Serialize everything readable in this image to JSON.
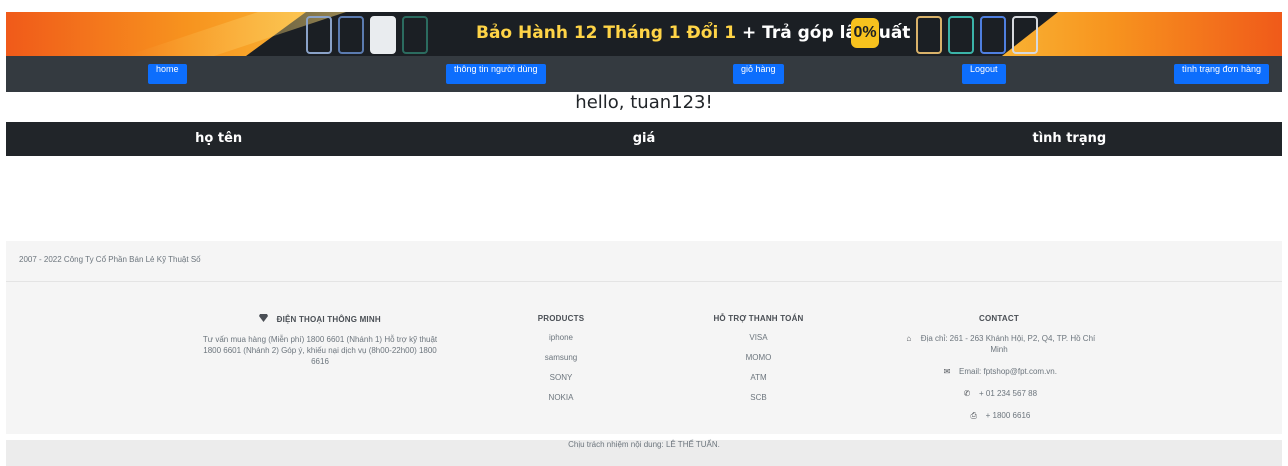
{
  "banner": {
    "warranty_text": "Bảo Hành 12 Tháng 1 Đổi 1",
    "plus": "+",
    "installment_text": "Trả góp lãi suất",
    "zero_percent": "0%"
  },
  "nav": {
    "home": "home",
    "user_info": "thông tin người dùng",
    "cart": "giỏ hàng",
    "logout": "Logout",
    "order_status": "tình trạng đơn hàng",
    "button_color": "#0d6efd",
    "bar_color": "#343a40"
  },
  "greeting": "hello, tuan123!",
  "table": {
    "headers": [
      "họ tên",
      "giá",
      "tình trạng"
    ],
    "rows": []
  },
  "footer": {
    "copyright": "2007 - 2022 Công Ty Cổ Phần Bán Lẻ Kỹ Thuật Số",
    "brand": {
      "icon": "gem-icon",
      "title": "ĐIỆN THOẠI THÔNG MINH",
      "description": "Tư vấn mua hàng (Miễn phí) 1800 6601 (Nhánh 1) Hỗ trợ kỹ thuật 1800 6601 (Nhánh 2) Góp ý, khiếu nại dịch vụ (8h00-22h00) 1800 6616"
    },
    "products": {
      "title": "PRODUCTS",
      "items": [
        "iphone",
        "samsung",
        "SONY",
        "NOKIA"
      ]
    },
    "payment": {
      "title": "HỖ TRỢ THANH TOÁN",
      "items": [
        "VISA",
        "MOMO",
        "ATM",
        "SCB"
      ]
    },
    "contact": {
      "title": "CONTACT",
      "address": "Địa chỉ: 261 - 263 Khánh Hội, P2, Q4, TP. Hồ Chí Minh",
      "email": "Email: fptshop@fpt.com.vn.",
      "phone": "+ 01 234 567 88",
      "fax": "+ 1800 6616"
    },
    "responsibility": "Chịu trách nhiệm nội dung: LÊ THẾ TUẤN."
  }
}
